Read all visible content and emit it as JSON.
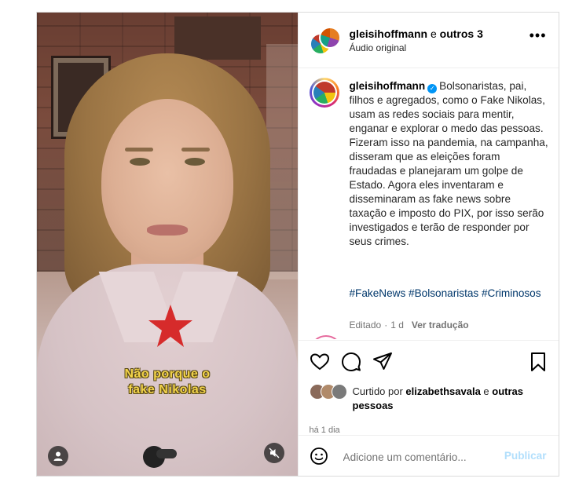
{
  "video": {
    "caption_line1": "Não porque o",
    "caption_line2": "fake Nikolas",
    "star_color": "#d62b2b",
    "caption_color": "#f2d34a"
  },
  "header": {
    "username": "gleisihoffmann",
    "joiner": " e ",
    "others": "outros 3",
    "subtitle": "Áudio original",
    "more": "•••"
  },
  "post": {
    "username": "gleisihoffmann",
    "verified_icon": "verified-badge-icon",
    "body": "Bolsonaristas, pai, filhos e agregados, como o Fake Nikolas, usam as redes sociais para mentir, enganar e explorar o medo das pessoas. Fizeram isso na pandemia, na campanha, disseram que as eleições foram fraudadas e planejaram um golpe de Estado. Agora eles inventaram e disseminaram as fake news sobre taxação e imposto do PIX, por isso serão investigados e terão de responder por seus crimes.",
    "hashtags": "#FakeNews #Bolsonaristas #Criminosos",
    "edited": "Editado",
    "age": "1 d",
    "translate": "Ver tradução"
  },
  "actions": {
    "liked_prefix": "Curtido por ",
    "liked_user": "elizabethsavala",
    "liked_joiner": " e ",
    "liked_others": "outras pessoas",
    "time": "há 1 dia"
  },
  "comment": {
    "placeholder": "Adicione um comentário...",
    "publish": "Publicar"
  },
  "colors": {
    "link": "#00376b",
    "accent": "#0095f6",
    "publish_disabled": "#b2dffc"
  }
}
